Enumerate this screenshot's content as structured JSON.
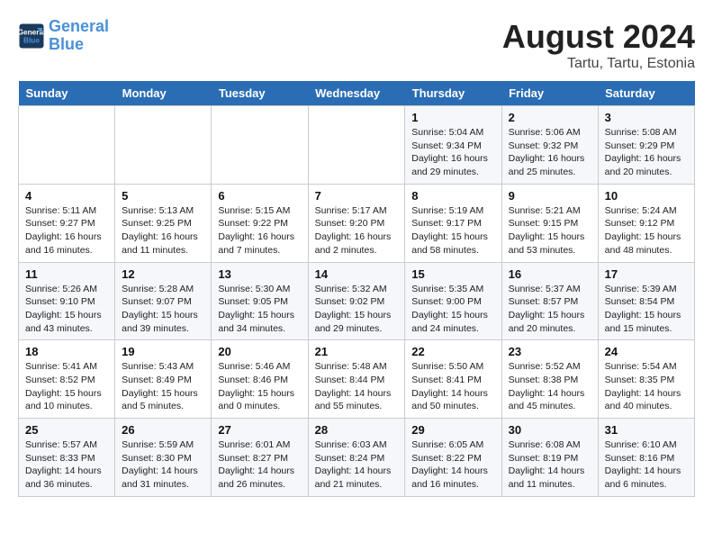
{
  "header": {
    "logo_line1": "General",
    "logo_line2": "Blue",
    "main_title": "August 2024",
    "subtitle": "Tartu, Tartu, Estonia"
  },
  "weekdays": [
    "Sunday",
    "Monday",
    "Tuesday",
    "Wednesday",
    "Thursday",
    "Friday",
    "Saturday"
  ],
  "weeks": [
    [
      {
        "day": "",
        "info": ""
      },
      {
        "day": "",
        "info": ""
      },
      {
        "day": "",
        "info": ""
      },
      {
        "day": "",
        "info": ""
      },
      {
        "day": "1",
        "info": "Sunrise: 5:04 AM\nSunset: 9:34 PM\nDaylight: 16 hours\nand 29 minutes."
      },
      {
        "day": "2",
        "info": "Sunrise: 5:06 AM\nSunset: 9:32 PM\nDaylight: 16 hours\nand 25 minutes."
      },
      {
        "day": "3",
        "info": "Sunrise: 5:08 AM\nSunset: 9:29 PM\nDaylight: 16 hours\nand 20 minutes."
      }
    ],
    [
      {
        "day": "4",
        "info": "Sunrise: 5:11 AM\nSunset: 9:27 PM\nDaylight: 16 hours\nand 16 minutes."
      },
      {
        "day": "5",
        "info": "Sunrise: 5:13 AM\nSunset: 9:25 PM\nDaylight: 16 hours\nand 11 minutes."
      },
      {
        "day": "6",
        "info": "Sunrise: 5:15 AM\nSunset: 9:22 PM\nDaylight: 16 hours\nand 7 minutes."
      },
      {
        "day": "7",
        "info": "Sunrise: 5:17 AM\nSunset: 9:20 PM\nDaylight: 16 hours\nand 2 minutes."
      },
      {
        "day": "8",
        "info": "Sunrise: 5:19 AM\nSunset: 9:17 PM\nDaylight: 15 hours\nand 58 minutes."
      },
      {
        "day": "9",
        "info": "Sunrise: 5:21 AM\nSunset: 9:15 PM\nDaylight: 15 hours\nand 53 minutes."
      },
      {
        "day": "10",
        "info": "Sunrise: 5:24 AM\nSunset: 9:12 PM\nDaylight: 15 hours\nand 48 minutes."
      }
    ],
    [
      {
        "day": "11",
        "info": "Sunrise: 5:26 AM\nSunset: 9:10 PM\nDaylight: 15 hours\nand 43 minutes."
      },
      {
        "day": "12",
        "info": "Sunrise: 5:28 AM\nSunset: 9:07 PM\nDaylight: 15 hours\nand 39 minutes."
      },
      {
        "day": "13",
        "info": "Sunrise: 5:30 AM\nSunset: 9:05 PM\nDaylight: 15 hours\nand 34 minutes."
      },
      {
        "day": "14",
        "info": "Sunrise: 5:32 AM\nSunset: 9:02 PM\nDaylight: 15 hours\nand 29 minutes."
      },
      {
        "day": "15",
        "info": "Sunrise: 5:35 AM\nSunset: 9:00 PM\nDaylight: 15 hours\nand 24 minutes."
      },
      {
        "day": "16",
        "info": "Sunrise: 5:37 AM\nSunset: 8:57 PM\nDaylight: 15 hours\nand 20 minutes."
      },
      {
        "day": "17",
        "info": "Sunrise: 5:39 AM\nSunset: 8:54 PM\nDaylight: 15 hours\nand 15 minutes."
      }
    ],
    [
      {
        "day": "18",
        "info": "Sunrise: 5:41 AM\nSunset: 8:52 PM\nDaylight: 15 hours\nand 10 minutes."
      },
      {
        "day": "19",
        "info": "Sunrise: 5:43 AM\nSunset: 8:49 PM\nDaylight: 15 hours\nand 5 minutes."
      },
      {
        "day": "20",
        "info": "Sunrise: 5:46 AM\nSunset: 8:46 PM\nDaylight: 15 hours\nand 0 minutes."
      },
      {
        "day": "21",
        "info": "Sunrise: 5:48 AM\nSunset: 8:44 PM\nDaylight: 14 hours\nand 55 minutes."
      },
      {
        "day": "22",
        "info": "Sunrise: 5:50 AM\nSunset: 8:41 PM\nDaylight: 14 hours\nand 50 minutes."
      },
      {
        "day": "23",
        "info": "Sunrise: 5:52 AM\nSunset: 8:38 PM\nDaylight: 14 hours\nand 45 minutes."
      },
      {
        "day": "24",
        "info": "Sunrise: 5:54 AM\nSunset: 8:35 PM\nDaylight: 14 hours\nand 40 minutes."
      }
    ],
    [
      {
        "day": "25",
        "info": "Sunrise: 5:57 AM\nSunset: 8:33 PM\nDaylight: 14 hours\nand 36 minutes."
      },
      {
        "day": "26",
        "info": "Sunrise: 5:59 AM\nSunset: 8:30 PM\nDaylight: 14 hours\nand 31 minutes."
      },
      {
        "day": "27",
        "info": "Sunrise: 6:01 AM\nSunset: 8:27 PM\nDaylight: 14 hours\nand 26 minutes."
      },
      {
        "day": "28",
        "info": "Sunrise: 6:03 AM\nSunset: 8:24 PM\nDaylight: 14 hours\nand 21 minutes."
      },
      {
        "day": "29",
        "info": "Sunrise: 6:05 AM\nSunset: 8:22 PM\nDaylight: 14 hours\nand 16 minutes."
      },
      {
        "day": "30",
        "info": "Sunrise: 6:08 AM\nSunset: 8:19 PM\nDaylight: 14 hours\nand 11 minutes."
      },
      {
        "day": "31",
        "info": "Sunrise: 6:10 AM\nSunset: 8:16 PM\nDaylight: 14 hours\nand 6 minutes."
      }
    ]
  ]
}
